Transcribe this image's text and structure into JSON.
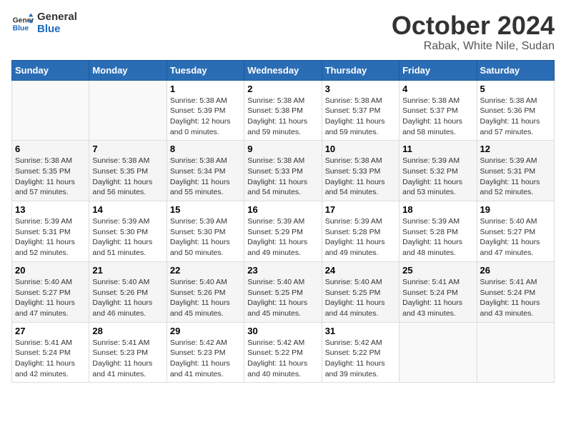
{
  "logo": {
    "general": "General",
    "blue": "Blue"
  },
  "title": "October 2024",
  "location": "Rabak, White Nile, Sudan",
  "days_of_week": [
    "Sunday",
    "Monday",
    "Tuesday",
    "Wednesday",
    "Thursday",
    "Friday",
    "Saturday"
  ],
  "weeks": [
    [
      {
        "day": "",
        "info": ""
      },
      {
        "day": "",
        "info": ""
      },
      {
        "day": "1",
        "info": "Sunrise: 5:38 AM\nSunset: 5:39 PM\nDaylight: 12 hours and 0 minutes."
      },
      {
        "day": "2",
        "info": "Sunrise: 5:38 AM\nSunset: 5:38 PM\nDaylight: 11 hours and 59 minutes."
      },
      {
        "day": "3",
        "info": "Sunrise: 5:38 AM\nSunset: 5:37 PM\nDaylight: 11 hours and 59 minutes."
      },
      {
        "day": "4",
        "info": "Sunrise: 5:38 AM\nSunset: 5:37 PM\nDaylight: 11 hours and 58 minutes."
      },
      {
        "day": "5",
        "info": "Sunrise: 5:38 AM\nSunset: 5:36 PM\nDaylight: 11 hours and 57 minutes."
      }
    ],
    [
      {
        "day": "6",
        "info": "Sunrise: 5:38 AM\nSunset: 5:35 PM\nDaylight: 11 hours and 57 minutes."
      },
      {
        "day": "7",
        "info": "Sunrise: 5:38 AM\nSunset: 5:35 PM\nDaylight: 11 hours and 56 minutes."
      },
      {
        "day": "8",
        "info": "Sunrise: 5:38 AM\nSunset: 5:34 PM\nDaylight: 11 hours and 55 minutes."
      },
      {
        "day": "9",
        "info": "Sunrise: 5:38 AM\nSunset: 5:33 PM\nDaylight: 11 hours and 54 minutes."
      },
      {
        "day": "10",
        "info": "Sunrise: 5:38 AM\nSunset: 5:33 PM\nDaylight: 11 hours and 54 minutes."
      },
      {
        "day": "11",
        "info": "Sunrise: 5:39 AM\nSunset: 5:32 PM\nDaylight: 11 hours and 53 minutes."
      },
      {
        "day": "12",
        "info": "Sunrise: 5:39 AM\nSunset: 5:31 PM\nDaylight: 11 hours and 52 minutes."
      }
    ],
    [
      {
        "day": "13",
        "info": "Sunrise: 5:39 AM\nSunset: 5:31 PM\nDaylight: 11 hours and 52 minutes."
      },
      {
        "day": "14",
        "info": "Sunrise: 5:39 AM\nSunset: 5:30 PM\nDaylight: 11 hours and 51 minutes."
      },
      {
        "day": "15",
        "info": "Sunrise: 5:39 AM\nSunset: 5:30 PM\nDaylight: 11 hours and 50 minutes."
      },
      {
        "day": "16",
        "info": "Sunrise: 5:39 AM\nSunset: 5:29 PM\nDaylight: 11 hours and 49 minutes."
      },
      {
        "day": "17",
        "info": "Sunrise: 5:39 AM\nSunset: 5:28 PM\nDaylight: 11 hours and 49 minutes."
      },
      {
        "day": "18",
        "info": "Sunrise: 5:39 AM\nSunset: 5:28 PM\nDaylight: 11 hours and 48 minutes."
      },
      {
        "day": "19",
        "info": "Sunrise: 5:40 AM\nSunset: 5:27 PM\nDaylight: 11 hours and 47 minutes."
      }
    ],
    [
      {
        "day": "20",
        "info": "Sunrise: 5:40 AM\nSunset: 5:27 PM\nDaylight: 11 hours and 47 minutes."
      },
      {
        "day": "21",
        "info": "Sunrise: 5:40 AM\nSunset: 5:26 PM\nDaylight: 11 hours and 46 minutes."
      },
      {
        "day": "22",
        "info": "Sunrise: 5:40 AM\nSunset: 5:26 PM\nDaylight: 11 hours and 45 minutes."
      },
      {
        "day": "23",
        "info": "Sunrise: 5:40 AM\nSunset: 5:25 PM\nDaylight: 11 hours and 45 minutes."
      },
      {
        "day": "24",
        "info": "Sunrise: 5:40 AM\nSunset: 5:25 PM\nDaylight: 11 hours and 44 minutes."
      },
      {
        "day": "25",
        "info": "Sunrise: 5:41 AM\nSunset: 5:24 PM\nDaylight: 11 hours and 43 minutes."
      },
      {
        "day": "26",
        "info": "Sunrise: 5:41 AM\nSunset: 5:24 PM\nDaylight: 11 hours and 43 minutes."
      }
    ],
    [
      {
        "day": "27",
        "info": "Sunrise: 5:41 AM\nSunset: 5:24 PM\nDaylight: 11 hours and 42 minutes."
      },
      {
        "day": "28",
        "info": "Sunrise: 5:41 AM\nSunset: 5:23 PM\nDaylight: 11 hours and 41 minutes."
      },
      {
        "day": "29",
        "info": "Sunrise: 5:42 AM\nSunset: 5:23 PM\nDaylight: 11 hours and 41 minutes."
      },
      {
        "day": "30",
        "info": "Sunrise: 5:42 AM\nSunset: 5:22 PM\nDaylight: 11 hours and 40 minutes."
      },
      {
        "day": "31",
        "info": "Sunrise: 5:42 AM\nSunset: 5:22 PM\nDaylight: 11 hours and 39 minutes."
      },
      {
        "day": "",
        "info": ""
      },
      {
        "day": "",
        "info": ""
      }
    ]
  ]
}
